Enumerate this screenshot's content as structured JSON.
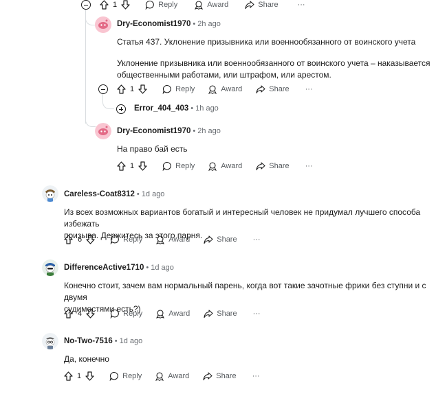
{
  "actions": {
    "reply": "Reply",
    "award": "Award",
    "share": "Share",
    "more": "···"
  },
  "comments": [
    {
      "score": "1"
    },
    {
      "author": "Dry-Economist1970",
      "time": "2h ago",
      "para1": "Статья 437. Уклонение призывника или военнообязанного от воинского учета",
      "para2a": "Уклонение призывника или военнообязанного от воинского учета – наказывается",
      "para2b": "общественными работами, или штрафом, или арестом.",
      "score": "1"
    },
    {
      "author": "Error_404_403",
      "time": "1h ago"
    },
    {
      "author": "Dry-Economist1970",
      "time": "2h ago",
      "text": "На право бай есть",
      "score": "1"
    },
    {
      "author": "Careless-Coat8312",
      "time": "1d ago",
      "line1": "Из всех возможных вариантов богатый и интересный человек не придумал лучшего способа избежать",
      "line2": "призыва. Держитесь за этого парня.",
      "score": "6"
    },
    {
      "author": "DifferenceActive1710",
      "time": "1d ago",
      "line1": "Конечно стоит, зачем вам нормальный парень, когда вот такие зачотные фрики без ступни и с двумя",
      "line2": "судимостями есть?)",
      "score": "4"
    },
    {
      "author": "No-Two-7516",
      "time": "1d ago",
      "text": "Да, конечно",
      "score": "1"
    }
  ]
}
